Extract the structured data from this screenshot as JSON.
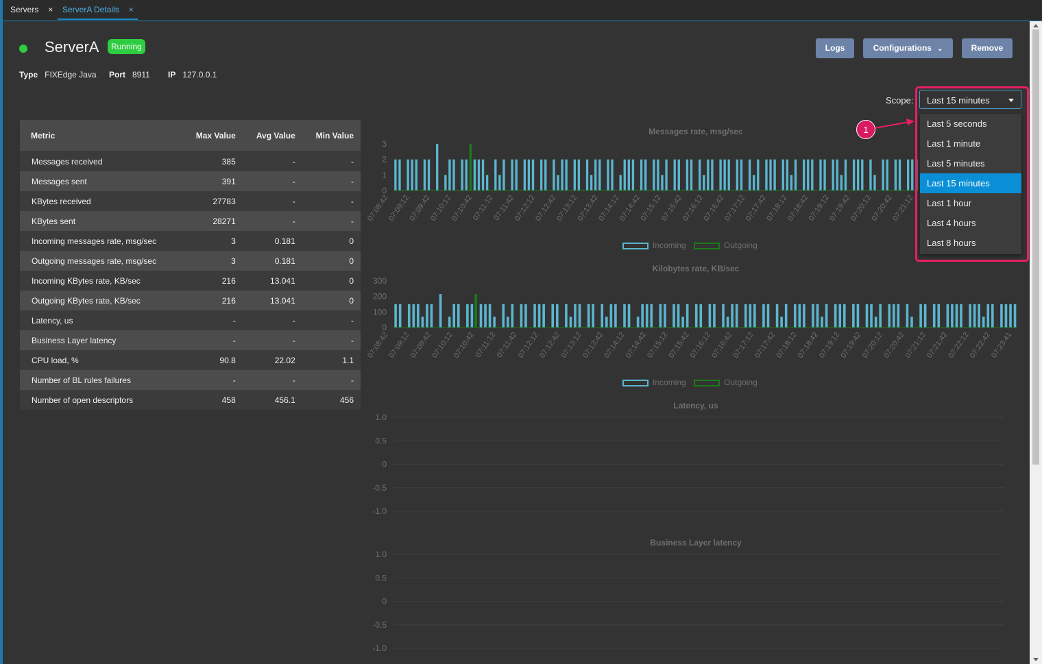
{
  "tabs": [
    {
      "label": "Servers",
      "close": "×"
    },
    {
      "label": "ServerA Details",
      "close": "×"
    }
  ],
  "server": {
    "name": "ServerA",
    "status": "Running",
    "type_label": "Type",
    "type_value": "FIXEdge Java",
    "port_label": "Port",
    "port_value": "8911",
    "ip_label": "IP",
    "ip_value": "127.0.0.1"
  },
  "actions": {
    "logs": "Logs",
    "configurations": "Configurations",
    "remove": "Remove"
  },
  "scope": {
    "label": "Scope:",
    "value": "Last 15 minutes",
    "options": [
      "Last 5 seconds",
      "Last 1 minute",
      "Last 5 minutes",
      "Last 15 minutes",
      "Last 1 hour",
      "Last 4 hours",
      "Last 8 hours"
    ],
    "selected_index": 3
  },
  "callout": {
    "number": "1"
  },
  "colors": {
    "accent": "#1d88c0",
    "running": "#2ecc40",
    "incoming": "#5bb6cf",
    "outgoing": "#1a7a1a",
    "highlight": "#e91e63"
  },
  "table": {
    "headers": [
      "Metric",
      "Max Value",
      "Avg Value",
      "Min Value"
    ],
    "rows": [
      [
        "Messages received",
        "385",
        "-",
        "-"
      ],
      [
        "Messages sent",
        "391",
        "-",
        "-"
      ],
      [
        "KBytes received",
        "27783",
        "-",
        "-"
      ],
      [
        "KBytes sent",
        "28271",
        "-",
        "-"
      ],
      [
        "Incoming messages rate, msg/sec",
        "3",
        "0.181",
        "0"
      ],
      [
        "Outgoing messages rate, msg/sec",
        "3",
        "0.181",
        "0"
      ],
      [
        "Incoming KBytes rate, KB/sec",
        "216",
        "13.041",
        "0"
      ],
      [
        "Outgoing KBytes rate, KB/sec",
        "216",
        "13.041",
        "0"
      ],
      [
        "Latency, us",
        "-",
        "-",
        "-"
      ],
      [
        "Business Layer latency",
        "-",
        "-",
        "-"
      ],
      [
        "CPU load, %",
        "90.8",
        "22.02",
        "1.1"
      ],
      [
        "Number of BL rules failures",
        "-",
        "-",
        "-"
      ],
      [
        "Number of open descriptors",
        "458",
        "456.1",
        "456"
      ]
    ]
  },
  "chart_data": [
    {
      "type": "area",
      "title": "Messages rate, msg/sec",
      "ylim": [
        0,
        3
      ],
      "yticks": [
        "0",
        "1",
        "2",
        "3"
      ],
      "xticks": [
        "07:08:42",
        "07:09:12",
        "07:09:42",
        "07:10:12",
        "07:10:42",
        "07:11:12",
        "07:11:42",
        "07:12:12",
        "07:12:42",
        "07:13:12",
        "07:13:42",
        "07:14:12",
        "07:14:42",
        "07:15:12",
        "07:15:42",
        "07:16:12",
        "07:16:42",
        "07:17:12",
        "07:17:42",
        "07:18:12",
        "07:18:42",
        "07:19:12",
        "07:19:42",
        "07:20:12",
        "07:20:42",
        "07:21:12"
      ],
      "legend": [
        "Incoming",
        "Outgoing"
      ],
      "series": [
        {
          "name": "Incoming",
          "values": [
            2,
            2,
            0,
            2,
            2,
            2,
            0,
            2,
            2,
            0,
            3,
            0,
            1,
            2,
            2,
            0,
            2,
            2,
            0,
            2,
            2,
            2,
            1,
            0,
            2,
            1,
            2,
            0,
            2,
            2,
            0,
            2,
            2,
            2,
            0,
            2,
            2,
            0,
            2,
            1,
            2,
            2,
            0,
            2,
            2,
            0,
            2,
            1,
            2,
            2,
            0,
            2,
            2,
            0,
            1,
            2,
            2,
            2,
            0,
            2,
            2,
            0,
            2,
            2,
            1,
            2,
            0,
            2,
            2,
            0,
            2,
            2,
            0,
            2,
            1,
            2,
            2,
            0,
            2,
            2,
            2,
            0,
            2,
            2,
            0,
            2,
            1,
            2,
            0,
            2,
            2,
            2,
            0,
            2,
            2,
            1,
            2,
            0,
            2,
            2,
            2,
            0,
            2,
            2,
            0,
            2,
            2,
            1,
            2,
            0,
            2,
            2,
            2,
            0,
            2,
            1,
            0,
            2,
            2,
            0,
            2,
            2,
            0,
            2,
            2,
            2
          ]
        },
        {
          "name": "Outgoing",
          "values": [
            0,
            0,
            0,
            0,
            0,
            0,
            0,
            0,
            0,
            0,
            0,
            0,
            0,
            0,
            0,
            0,
            0,
            0,
            3,
            0,
            0,
            0,
            0,
            0,
            0,
            0,
            0,
            0,
            0,
            0,
            0,
            0,
            0,
            0,
            0,
            0,
            0,
            0,
            0,
            0,
            0,
            0,
            0,
            0,
            0,
            0,
            0,
            0,
            0,
            0,
            0,
            0,
            0,
            0,
            0,
            0,
            0,
            0,
            0,
            0,
            0,
            0,
            0,
            0,
            0,
            0,
            0,
            0,
            0,
            0,
            0,
            0,
            0,
            0,
            0,
            0,
            0,
            0,
            0,
            0,
            0,
            0,
            0,
            0,
            0,
            0,
            0,
            0,
            0,
            0,
            0,
            0,
            0,
            0,
            0,
            0,
            0,
            0,
            0,
            0,
            0,
            0,
            0,
            0,
            0,
            0,
            0,
            0,
            0,
            0,
            0,
            0,
            0,
            0,
            0,
            0,
            0,
            0,
            0,
            0,
            0,
            0,
            0,
            0,
            0,
            0
          ]
        }
      ]
    },
    {
      "type": "area",
      "title": "Kilobytes rate, KB/sec",
      "ylim": [
        0,
        300
      ],
      "yticks": [
        "0",
        "100",
        "200",
        "300"
      ],
      "xticks": [
        "07:08:42",
        "07:09:12",
        "07:09:42",
        "07:10:12",
        "07:10:42",
        "07:11:12",
        "07:11:42",
        "07:12:12",
        "07:12:42",
        "07:13:12",
        "07:13:42",
        "07:14:12",
        "07:14:42",
        "07:15:12",
        "07:15:42",
        "07:16:12",
        "07:16:42",
        "07:17:12",
        "07:17:42",
        "07:18:12",
        "07:18:42",
        "07:19:12",
        "07:19:42",
        "07:20:12",
        "07:20:42",
        "07:21:12",
        "07:21:42",
        "07:22:12",
        "07:22:42",
        "07:23:41"
      ],
      "legend": [
        "Incoming",
        "Outgoing"
      ],
      "series": [
        {
          "name": "Incoming",
          "values": [
            150,
            150,
            0,
            150,
            150,
            150,
            70,
            150,
            150,
            0,
            216,
            0,
            70,
            150,
            150,
            0,
            150,
            150,
            0,
            150,
            150,
            150,
            70,
            0,
            150,
            70,
            150,
            0,
            150,
            150,
            0,
            150,
            150,
            150,
            0,
            150,
            150,
            0,
            150,
            70,
            150,
            150,
            0,
            150,
            150,
            0,
            150,
            70,
            150,
            150,
            0,
            150,
            150,
            0,
            70,
            150,
            150,
            150,
            0,
            150,
            150,
            0,
            150,
            150,
            70,
            150,
            0,
            150,
            150,
            0,
            150,
            150,
            0,
            150,
            70,
            150,
            150,
            0,
            150,
            150,
            150,
            0,
            150,
            150,
            0,
            150,
            70,
            150,
            0,
            150,
            150,
            150,
            0,
            150,
            150,
            70,
            150,
            0,
            150,
            150,
            150,
            0,
            150,
            150,
            0,
            150,
            150,
            70,
            150,
            0,
            150,
            150,
            150,
            0,
            150,
            70,
            0,
            150,
            150,
            0,
            150,
            150,
            0,
            150,
            150,
            150,
            150,
            0,
            150,
            150,
            150,
            70,
            150,
            150,
            0,
            150,
            150,
            150,
            150
          ]
        },
        {
          "name": "Outgoing",
          "values": [
            0,
            0,
            0,
            0,
            0,
            0,
            0,
            0,
            0,
            0,
            0,
            0,
            0,
            0,
            0,
            0,
            0,
            0,
            216,
            0,
            0,
            0,
            0,
            0,
            0,
            0,
            0,
            0,
            0,
            0,
            0,
            0,
            0,
            0,
            0,
            0,
            0,
            0,
            0,
            0,
            0,
            0,
            0,
            0,
            0,
            0,
            0,
            0,
            0,
            0,
            0,
            0,
            0,
            0,
            0,
            0,
            0,
            0,
            0,
            0,
            0,
            0,
            0,
            0,
            0,
            0,
            0,
            0,
            0,
            0,
            0,
            0,
            0,
            0,
            0,
            0,
            0,
            0,
            0,
            0,
            0,
            0,
            0,
            0,
            0,
            0,
            0,
            0,
            0,
            0,
            0,
            0,
            0,
            0,
            0,
            0,
            0,
            0,
            0,
            0,
            0,
            0,
            0,
            0,
            0,
            0,
            0,
            0,
            0,
            0,
            0,
            0,
            0,
            0,
            0,
            0,
            0,
            0,
            0,
            0,
            0,
            0,
            0,
            0,
            0,
            0,
            0,
            0,
            0,
            0,
            0,
            0,
            0,
            0,
            0,
            0,
            0,
            0,
            0,
            0
          ]
        }
      ]
    },
    {
      "type": "line",
      "title": "Latency, us",
      "ylim": [
        -1.0,
        1.0
      ],
      "yticks": [
        "1.0",
        "0.5",
        "0",
        "-0.5",
        "-1.0"
      ],
      "series": []
    },
    {
      "type": "line",
      "title": "Business Layer latency",
      "ylim": [
        -1.0,
        1.0
      ],
      "yticks": [
        "1.0",
        "0.5",
        "0",
        "-0.5",
        "-1.0"
      ],
      "series": []
    }
  ]
}
